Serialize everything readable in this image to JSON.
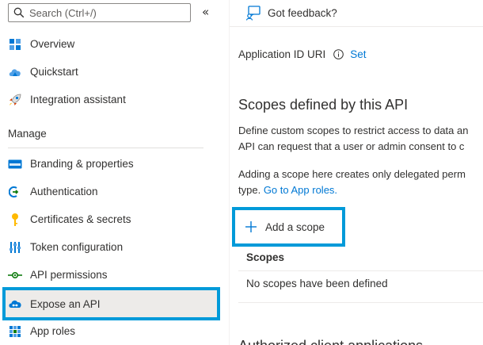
{
  "sidebar": {
    "search_placeholder": "Search (Ctrl+/)",
    "collapse_glyph": "«",
    "top_items": [
      {
        "label": "Overview",
        "icon": "overview-icon"
      },
      {
        "label": "Quickstart",
        "icon": "quickstart-icon"
      },
      {
        "label": "Integration assistant",
        "icon": "rocket-icon"
      }
    ],
    "section_header": "Manage",
    "manage_items": [
      {
        "label": "Branding & properties",
        "icon": "branding-icon"
      },
      {
        "label": "Authentication",
        "icon": "authentication-icon"
      },
      {
        "label": "Certificates & secrets",
        "icon": "key-icon"
      },
      {
        "label": "Token configuration",
        "icon": "token-icon"
      },
      {
        "label": "API permissions",
        "icon": "api-permissions-icon"
      },
      {
        "label": "Expose an API",
        "icon": "cloud-api-icon",
        "selected": true
      },
      {
        "label": "App roles",
        "icon": "app-roles-icon"
      }
    ]
  },
  "toolbar": {
    "feedback_label": "Got feedback?"
  },
  "main": {
    "application_id_label": "Application ID URI",
    "application_id_action": "Set",
    "scopes_title": "Scopes defined by this API",
    "description_line1": "Define custom scopes to restrict access to data an",
    "description_line2": "API can request that a user or admin consent to c",
    "note_line1": "Adding a scope here creates only delegated perm",
    "note_line2_prefix": "type.",
    "note_line2_link": "Go to App roles.",
    "add_scope_label": "Add a scope",
    "table_header": "Scopes",
    "empty_message": "No scopes have been defined",
    "next_heading": "Authorized client applications"
  },
  "colors": {
    "accent": "#0078d4",
    "highlight_border": "#009ad9",
    "selected_bg": "#edebe9"
  }
}
